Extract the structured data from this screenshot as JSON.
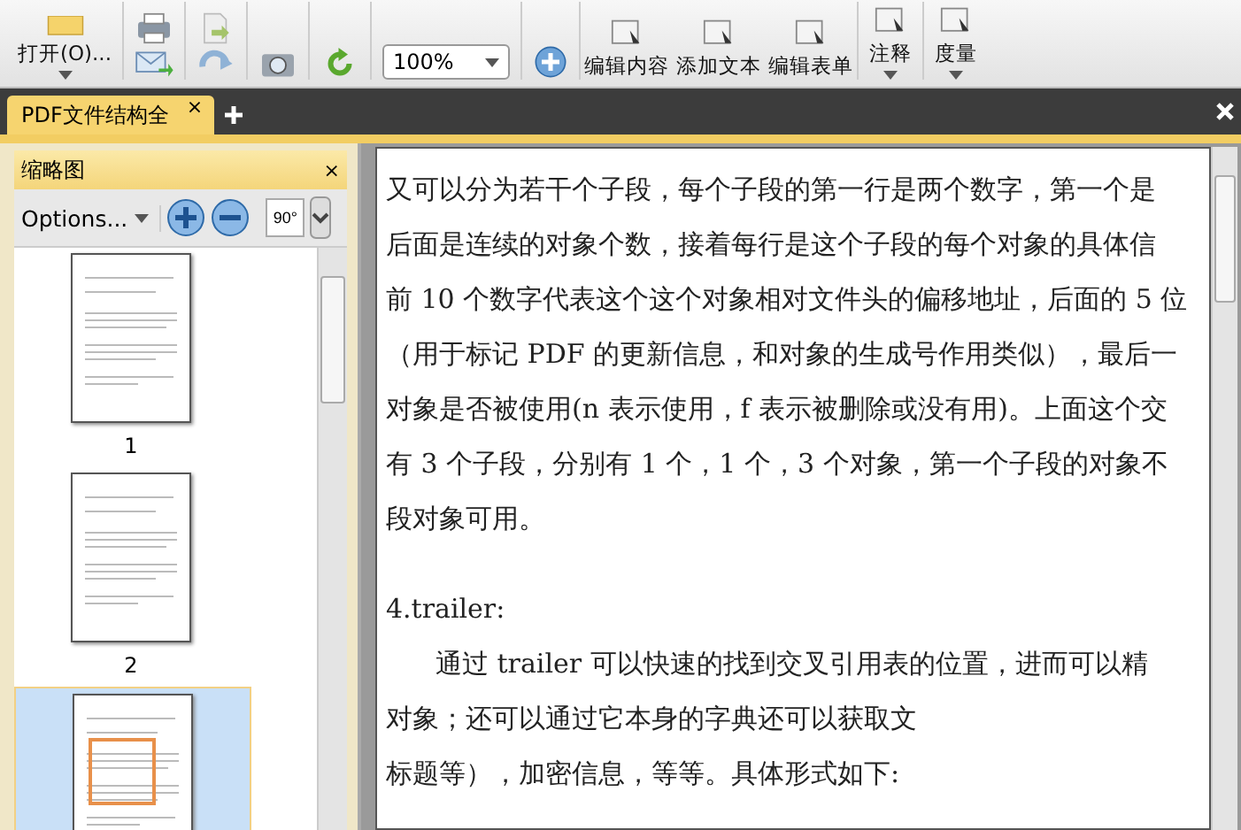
{
  "toolbar": {
    "open_label": "打开(O)...",
    "zoom_value": "100%",
    "tools": [
      {
        "label": "编辑内容",
        "has_menu": false
      },
      {
        "label": "添加文本",
        "has_menu": false
      },
      {
        "label": "编辑表单",
        "has_menu": false
      },
      {
        "label": "注释",
        "has_menu": true
      },
      {
        "label": "度量",
        "has_menu": true
      }
    ]
  },
  "tabs": [
    {
      "label": "PDF文件结构全",
      "selected": true,
      "close": "×"
    }
  ],
  "sidebar": {
    "title": "缩略图",
    "close": "×",
    "options_label": "Options...",
    "rotate_label": "90°",
    "thumbnails": [
      {
        "page": "1",
        "selected": false
      },
      {
        "page": "2",
        "selected": false
      },
      {
        "selected": true
      }
    ]
  },
  "document": {
    "lines": [
      {
        "kind": "line",
        "text": "又可以分为若干个子段，每个子段的第一行是两个数字，第一个是"
      },
      {
        "kind": "line",
        "text": "后面是连续的对象个数，接着每行是这个子段的每个对象的具体信"
      },
      {
        "kind": "line",
        "text": "前 10 个数字代表这个这个对象相对文件头的偏移地址，后面的 5 位"
      },
      {
        "kind": "line",
        "text": "（用于标记 PDF 的更新信息，和对象的生成号作用类似），最后一"
      },
      {
        "kind": "line",
        "text": "对象是否被使用(n 表示使用，f 表示被删除或没有用)。上面这个交"
      },
      {
        "kind": "line",
        "text": "有 3 个子段，分别有 1 个，1 个，3 个对象，第一个子段的对象不"
      },
      {
        "kind": "line",
        "text": "段对象可用。"
      },
      {
        "kind": "blank"
      },
      {
        "kind": "line",
        "text": "4.trailer:"
      },
      {
        "kind": "indent",
        "text": "通过 trailer 可以快速的找到交叉引用表的位置，进而可以精"
      },
      {
        "kind": "line",
        "text": "对象；还可以通过它本身的字典还可以获取文"
      },
      {
        "kind": "line",
        "text": "标题等），加密信息，等等。具体形式如下:"
      }
    ]
  }
}
